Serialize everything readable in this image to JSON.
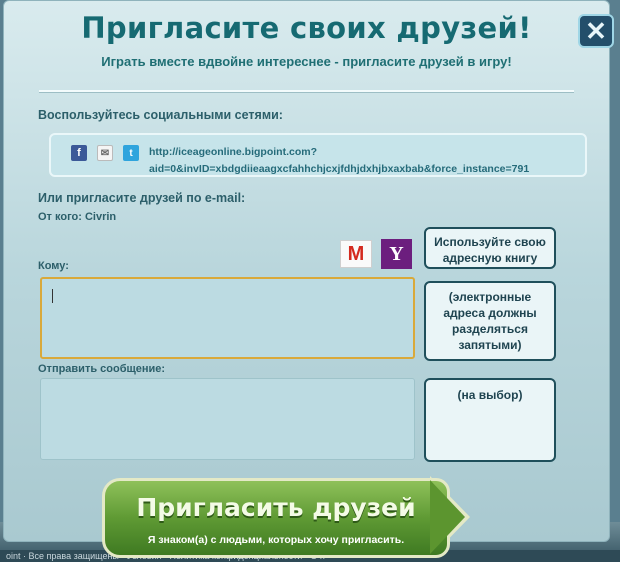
{
  "dialog": {
    "title": "Пригласите своих друзей!",
    "subtitle": "Играть вместе вдвойне интереснее - пригласите друзей в игру!",
    "close_glyph": "✕"
  },
  "social": {
    "label": "Воспользуйтесь социальными сетями:",
    "link_line1": "http://iceageonline.bigpoint.com?",
    "link_line2": "aid=0&invID=xbdgdiieaagxcfahhchjcxjfdhjdxhjbxaxbab&force_instance=791",
    "icons": [
      "facebook-icon",
      "mail-icon",
      "twitter-icon"
    ]
  },
  "email": {
    "label": "Или пригласите друзей по e-mail:",
    "from_line": "От кого: Civrin",
    "to_label": "Кому:",
    "to_value": "",
    "message_label": "Отправить сообщение:",
    "message_value": "",
    "gmail_glyph": "M",
    "yahoo_glyph": "Y"
  },
  "side": {
    "address_book": "Используйте свою адресную книгу",
    "separator_hint": "(электронные адреса должны разделяться запятыми)",
    "optional_hint": "(на выбор)"
  },
  "invite_button": {
    "label": "Пригласить друзей",
    "sublabel": "Я знаком(а) с людьми, которых хочу пригласить."
  },
  "background": {
    "footer_text": "oint · Все права защищены · Условия · Политика конфиденциальности · О н"
  },
  "colors": {
    "title": "#166a72",
    "accent_green": "#5f9a34",
    "focus_border": "#d9a93a"
  }
}
